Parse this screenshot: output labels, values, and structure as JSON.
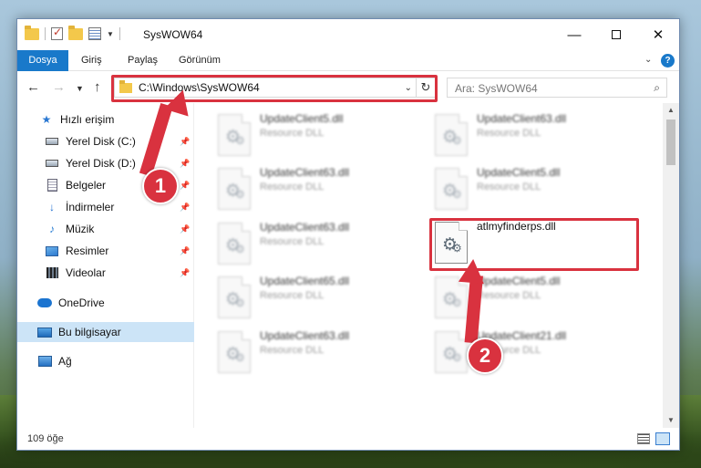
{
  "window": {
    "title": "SysWOW64"
  },
  "ribbon": {
    "tabs": [
      "Dosya",
      "Giriş",
      "Paylaş",
      "Görünüm"
    ],
    "help": "?"
  },
  "address": {
    "path": "C:\\Windows\\SysWOW64",
    "search_placeholder": "Ara: SysWOW64"
  },
  "nav": {
    "quick_access": "Hızlı erişim",
    "items": [
      {
        "label": "Yerel Disk (C:)",
        "icon": "disk-icon"
      },
      {
        "label": "Yerel Disk (D:)",
        "icon": "disk-icon"
      },
      {
        "label": "Belgeler",
        "icon": "documents-icon"
      },
      {
        "label": "İndirmeler",
        "icon": "downloads-icon"
      },
      {
        "label": "Müzik",
        "icon": "music-icon"
      },
      {
        "label": "Resimler",
        "icon": "pictures-icon"
      },
      {
        "label": "Videolar",
        "icon": "videos-icon"
      }
    ],
    "onedrive": "OneDrive",
    "this_pc": "Bu bilgisayar",
    "network": "Ağ"
  },
  "files": [
    {
      "name": "UpdateClient5.dll",
      "type": "Resource DLL"
    },
    {
      "name": "UpdateClient63.dll",
      "type": "Resource DLL"
    },
    {
      "name": "UpdateClient63.dll",
      "type": "Resource DLL"
    },
    {
      "name": "UpdateClient5.dll",
      "type": "Resource DLL"
    },
    {
      "name": "UpdateClient63.dll",
      "type": "Resource DLL"
    },
    {
      "name": "atlmyfinderps.dll",
      "type": ""
    },
    {
      "name": "UpdateClient65.dll",
      "type": "Resource DLL"
    },
    {
      "name": "UpdateClient5.dll",
      "type": "Resource DLL"
    },
    {
      "name": "UpdateClient63.dll",
      "type": "Resource DLL"
    },
    {
      "name": "UpdateClient21.dll",
      "type": "Resource DLL"
    }
  ],
  "status": {
    "count": "109 öğe"
  },
  "callouts": [
    "1",
    "2"
  ],
  "colors": {
    "accent": "#1979ca",
    "highlight": "#d9323f",
    "selection": "#cce4f7"
  }
}
